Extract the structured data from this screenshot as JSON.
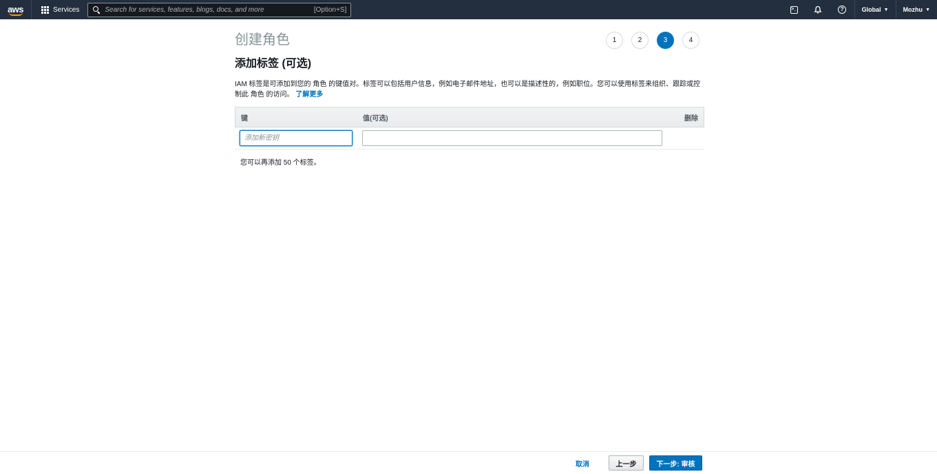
{
  "nav": {
    "logo_text": "aws",
    "services_label": "Services",
    "search_placeholder": "Search for services, features, blogs, docs, and more",
    "search_shortcut": "[Option+S]",
    "region_label": "Global",
    "user_label": "Mozhu",
    "terminal_glyph": ">_"
  },
  "page": {
    "title": "创建角色",
    "section_title": "添加标签 (可选)",
    "description": "IAM 标签是可添加到您的 角色 的键值对。标签可以包括用户信息，例如电子邮件地址，也可以是描述性的，例如职位。您可以使用标签来组织、跟踪或控制此 角色 的访问。",
    "learn_more": "了解更多",
    "steps": [
      "1",
      "2",
      "3",
      "4"
    ],
    "active_step": 3
  },
  "tags_table": {
    "headers": {
      "key": "键",
      "value": "值(可选)",
      "delete": "删除"
    },
    "key_placeholder": "添加新密钥",
    "key_value": "",
    "value_value": "",
    "remaining_text": "您可以再添加 50 个标签。"
  },
  "footer": {
    "cancel_label": "取消",
    "prev_label": "上一步",
    "next_label": "下一步: 审核"
  },
  "colors": {
    "nav_bg": "#232f3e",
    "accent": "#0073bb",
    "logo_smile": "#ff9900"
  }
}
